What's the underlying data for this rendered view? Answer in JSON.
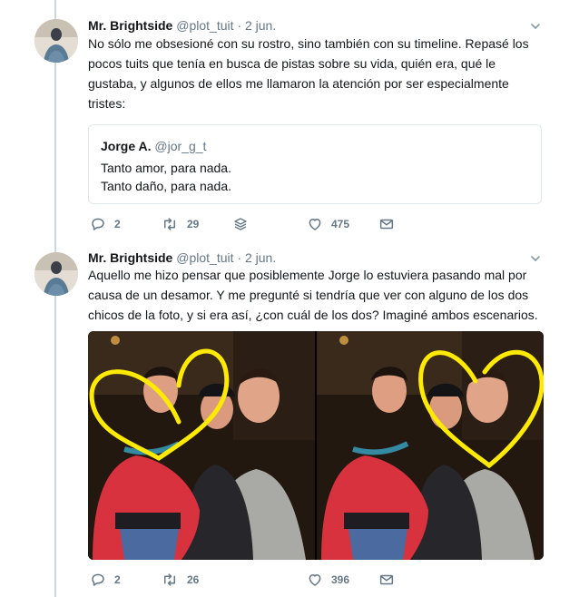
{
  "tweets": [
    {
      "author": {
        "name": "Mr. Brightside",
        "handle": "@plot_tuit",
        "dot": "·",
        "date": "2 jun."
      },
      "text": "No sólo me obsesioné con su rostro, sino también con su timeline. Repasé los pocos tuits que tenía en busca de pistas sobre su vida, quién era, qué le gustaba, y algunos de ellos me llamaron la atención por ser especialmente tristes:",
      "quote": {
        "name": "Jorge A.",
        "handle": "@jor_g_t",
        "lines": [
          "Tanto amor, para nada.",
          "Tanto daño, para nada."
        ]
      },
      "actions": {
        "replies": "2",
        "retweets": "29",
        "likes": "475"
      }
    },
    {
      "author": {
        "name": "Mr. Brightside",
        "handle": "@plot_tuit",
        "dot": "·",
        "date": "2 jun."
      },
      "text": "Aquello me hizo pensar que posiblemente Jorge lo estuviera pasando mal por causa de un desamor. Y me pregunté si tendría que ver con alguno de los dos chicos de la foto, y si era así, ¿con cuál de los dos? Imaginé ambos escenarios.",
      "actions": {
        "replies": "2",
        "retweets": "26",
        "likes": "396"
      }
    }
  ],
  "icons": {
    "reply": "reply-icon",
    "retweet": "retweet-icon",
    "stack": "stack-icon",
    "like": "heart-icon",
    "dm": "mail-icon",
    "caret": "chevron-down-icon"
  },
  "colors": {
    "secondary_text": "#657786",
    "border": "#e1e8ed",
    "heart_outline": "#ffea00",
    "thread_line": "#ccd6dd"
  }
}
